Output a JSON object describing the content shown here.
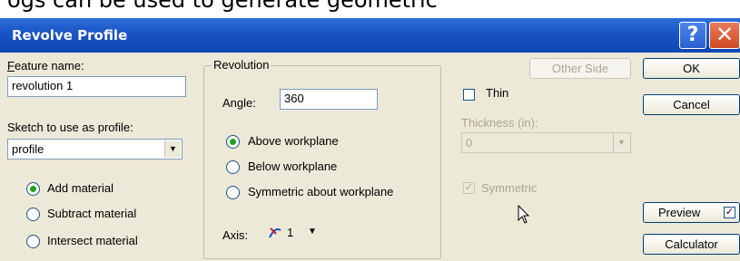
{
  "header_fragment": "ogs can be used to generate geometric",
  "window": {
    "title": "Revolve Profile",
    "help_label": "?",
    "close_label": "✕"
  },
  "feature_name": {
    "label": "Feature name:",
    "value": "revolution 1"
  },
  "sketch": {
    "label": "Sketch to use as profile:",
    "value": "profile"
  },
  "material": {
    "add": "Add material",
    "subtract": "Subtract material",
    "intersect": "Intersect material",
    "selected": "add"
  },
  "revolution": {
    "legend": "Revolution",
    "angle_label": "Angle:",
    "angle_value": "360",
    "above": "Above workplane",
    "below": "Below workplane",
    "symmetric": "Symmetric about workplane",
    "selected": "above",
    "axis_label": "Axis:",
    "axis_value": "1"
  },
  "thin": {
    "label": "Thin",
    "checked": false,
    "thickness_label": "Thickness (in):",
    "thickness_value": "0",
    "symmetric_label": "Symmetric",
    "symmetric_checked": true
  },
  "buttons": {
    "other_side": "Other Side",
    "ok": "OK",
    "cancel": "Cancel",
    "preview": "Preview",
    "preview_checked": true,
    "calculator": "Calculator"
  },
  "colors": {
    "title_bar": "#1a55c6",
    "dialog_bg": "#ece9d8",
    "disabled_text": "#a9a691"
  }
}
